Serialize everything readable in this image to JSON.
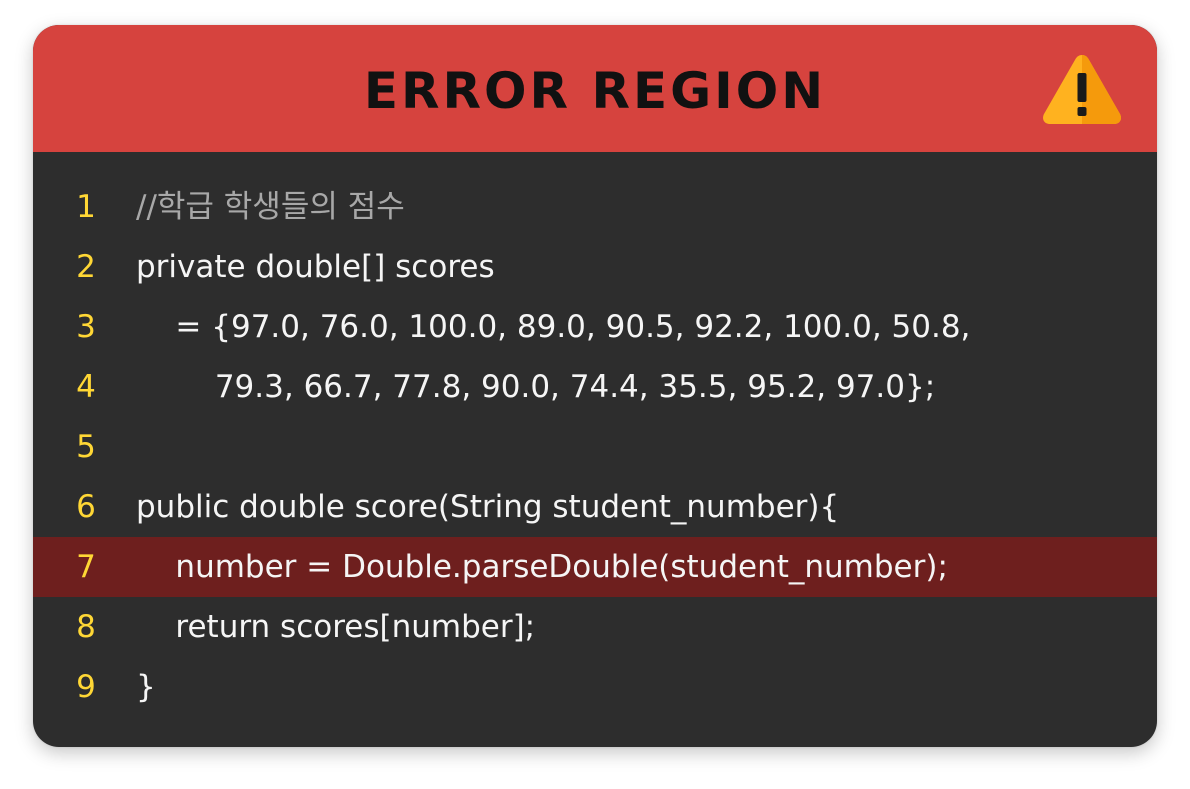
{
  "header": {
    "title": "ERROR REGION",
    "icon": "warning-icon",
    "background_color": "#d6433e"
  },
  "code": {
    "error_line": 7,
    "lines": [
      {
        "number": "1",
        "text": "//학급 학생들의 점수",
        "kind": "comment"
      },
      {
        "number": "2",
        "text": "private double[] scores",
        "kind": "code"
      },
      {
        "number": "3",
        "text": "    = {97.0, 76.0, 100.0, 89.0, 90.5, 92.2, 100.0, 50.8,",
        "kind": "code"
      },
      {
        "number": "4",
        "text": "        79.3, 66.7, 77.8, 90.0, 74.4, 35.5, 95.2, 97.0};",
        "kind": "code"
      },
      {
        "number": "5",
        "text": "",
        "kind": "code"
      },
      {
        "number": "6",
        "text": "public double score(String student_number){",
        "kind": "code"
      },
      {
        "number": "7",
        "text": "    number = Double.parseDouble(student_number);",
        "kind": "error"
      },
      {
        "number": "8",
        "text": "    return scores[number];",
        "kind": "code"
      },
      {
        "number": "9",
        "text": "}",
        "kind": "code"
      }
    ]
  },
  "colors": {
    "code_background": "#2d2d2d",
    "error_highlight": "#6e1f1e",
    "line_number": "#ffd735",
    "comment": "#a8a8a8",
    "code_text": "#f5f5f5"
  }
}
